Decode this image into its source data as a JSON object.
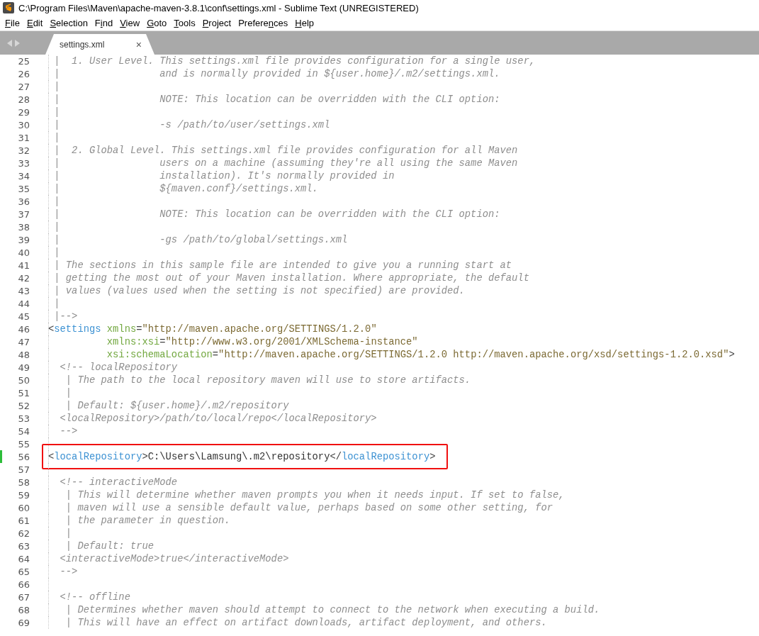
{
  "window": {
    "title": "C:\\Program Files\\Maven\\apache-maven-3.8.1\\conf\\settings.xml - Sublime Text (UNREGISTERED)"
  },
  "menu": [
    {
      "label": [
        {
          "text": "F",
          "underlined": true
        },
        {
          "text": "ile",
          "underlined": false
        }
      ]
    },
    {
      "label": [
        {
          "text": "E",
          "underlined": true
        },
        {
          "text": "dit",
          "underlined": false
        }
      ]
    },
    {
      "label": [
        {
          "text": "S",
          "underlined": true
        },
        {
          "text": "election",
          "underlined": false
        }
      ]
    },
    {
      "label": [
        {
          "text": "F",
          "underlined": false
        },
        {
          "text": "i",
          "underlined": true
        },
        {
          "text": "nd",
          "underlined": false
        }
      ]
    },
    {
      "label": [
        {
          "text": "V",
          "underlined": true
        },
        {
          "text": "iew",
          "underlined": false
        }
      ]
    },
    {
      "label": [
        {
          "text": "G",
          "underlined": true
        },
        {
          "text": "oto",
          "underlined": false
        }
      ]
    },
    {
      "label": [
        {
          "text": "T",
          "underlined": true
        },
        {
          "text": "ools",
          "underlined": false
        }
      ]
    },
    {
      "label": [
        {
          "text": "P",
          "underlined": true
        },
        {
          "text": "roject",
          "underlined": false
        }
      ]
    },
    {
      "label": [
        {
          "text": "Prefere",
          "underlined": false
        },
        {
          "text": "n",
          "underlined": true
        },
        {
          "text": "ces",
          "underlined": false
        }
      ]
    },
    {
      "label": [
        {
          "text": "H",
          "underlined": true
        },
        {
          "text": "elp",
          "underlined": false
        }
      ]
    }
  ],
  "tabs": [
    {
      "label": "settings.xml",
      "close": "×",
      "selected": true
    }
  ],
  "editor": {
    "lines": [
      {
        "number": "25",
        "parts": [
          {
            "kind": "comment",
            "text": " |  1. User Level. This settings.xml file provides configuration for a single user,"
          }
        ]
      },
      {
        "number": "26",
        "parts": [
          {
            "kind": "comment",
            "text": " |                 and is normally provided in ${user.home}/.m2/settings.xml."
          }
        ]
      },
      {
        "number": "27",
        "parts": [
          {
            "kind": "comment",
            "text": " |"
          }
        ]
      },
      {
        "number": "28",
        "parts": [
          {
            "kind": "comment",
            "text": " |                 NOTE: This location can be overridden with the CLI option:"
          }
        ]
      },
      {
        "number": "29",
        "parts": [
          {
            "kind": "comment",
            "text": " |"
          }
        ]
      },
      {
        "number": "30",
        "parts": [
          {
            "kind": "comment",
            "text": " |                 -s /path/to/user/settings.xml"
          }
        ]
      },
      {
        "number": "31",
        "parts": [
          {
            "kind": "comment",
            "text": " |"
          }
        ]
      },
      {
        "number": "32",
        "parts": [
          {
            "kind": "comment",
            "text": " |  2. Global Level. This settings.xml file provides configuration for all Maven"
          }
        ]
      },
      {
        "number": "33",
        "parts": [
          {
            "kind": "comment",
            "text": " |                 users on a machine (assuming they're all using the same Maven"
          }
        ]
      },
      {
        "number": "34",
        "parts": [
          {
            "kind": "comment",
            "text": " |                 installation). It's normally provided in"
          }
        ]
      },
      {
        "number": "35",
        "parts": [
          {
            "kind": "comment",
            "text": " |                 ${maven.conf}/settings.xml."
          }
        ]
      },
      {
        "number": "36",
        "parts": [
          {
            "kind": "comment",
            "text": " |"
          }
        ]
      },
      {
        "number": "37",
        "parts": [
          {
            "kind": "comment",
            "text": " |                 NOTE: This location can be overridden with the CLI option:"
          }
        ]
      },
      {
        "number": "38",
        "parts": [
          {
            "kind": "comment",
            "text": " |"
          }
        ]
      },
      {
        "number": "39",
        "parts": [
          {
            "kind": "comment",
            "text": " |                 -gs /path/to/global/settings.xml"
          }
        ]
      },
      {
        "number": "40",
        "parts": [
          {
            "kind": "comment",
            "text": " |"
          }
        ]
      },
      {
        "number": "41",
        "parts": [
          {
            "kind": "comment",
            "text": " | The sections in this sample file are intended to give you a running start at"
          }
        ]
      },
      {
        "number": "42",
        "parts": [
          {
            "kind": "comment",
            "text": " | getting the most out of your Maven installation. Where appropriate, the default"
          }
        ]
      },
      {
        "number": "43",
        "parts": [
          {
            "kind": "comment",
            "text": " | values (values used when the setting is not specified) are provided."
          }
        ]
      },
      {
        "number": "44",
        "parts": [
          {
            "kind": "comment",
            "text": " |"
          }
        ]
      },
      {
        "number": "45",
        "parts": [
          {
            "kind": "comment",
            "text": " |-->"
          }
        ]
      },
      {
        "number": "46",
        "parts": [
          {
            "kind": "punct",
            "text": "<"
          },
          {
            "kind": "tag",
            "text": "settings"
          },
          {
            "kind": "attr",
            "text": " xmlns"
          },
          {
            "kind": "punct",
            "text": "="
          },
          {
            "kind": "string",
            "text": "\"http://maven.apache.org/SETTINGS/1.2.0\""
          }
        ]
      },
      {
        "number": "47",
        "parts": [
          {
            "kind": "attr",
            "text": "          xmlns:xsi"
          },
          {
            "kind": "punct",
            "text": "="
          },
          {
            "kind": "string",
            "text": "\"http://www.w3.org/2001/XMLSchema-instance\""
          }
        ]
      },
      {
        "number": "48",
        "parts": [
          {
            "kind": "attr",
            "text": "          xsi:schemaLocation"
          },
          {
            "kind": "punct",
            "text": "="
          },
          {
            "kind": "string",
            "text": "\"http://maven.apache.org/SETTINGS/1.2.0 http://maven.apache.org/xsd/settings-1.2.0.xsd\""
          },
          {
            "kind": "punct",
            "text": ">"
          }
        ]
      },
      {
        "number": "49",
        "parts": [
          {
            "kind": "comment",
            "text": "  <!-- localRepository"
          }
        ]
      },
      {
        "number": "50",
        "parts": [
          {
            "kind": "comment",
            "text": "   | The path to the local repository maven will use to store artifacts."
          }
        ]
      },
      {
        "number": "51",
        "parts": [
          {
            "kind": "comment",
            "text": "   |"
          }
        ]
      },
      {
        "number": "52",
        "parts": [
          {
            "kind": "comment",
            "text": "   | Default: ${user.home}/.m2/repository"
          }
        ]
      },
      {
        "number": "53",
        "parts": [
          {
            "kind": "comment",
            "text": "  <localRepository>/path/to/local/repo</localRepository>"
          }
        ]
      },
      {
        "number": "54",
        "parts": [
          {
            "kind": "comment",
            "text": "  -->"
          }
        ]
      },
      {
        "number": "55"
      },
      {
        "number": "56",
        "modified": true,
        "annotated": true,
        "parts": [
          {
            "kind": "punct",
            "text": "<"
          },
          {
            "kind": "tag",
            "text": "localRepository"
          },
          {
            "kind": "punct",
            "text": ">"
          },
          {
            "kind": "text",
            "text": "C:\\Users\\Lamsung\\.m2\\repository"
          },
          {
            "kind": "punct",
            "text": "</"
          },
          {
            "kind": "tag",
            "text": "localRepository"
          },
          {
            "kind": "punct",
            "text": ">"
          }
        ]
      },
      {
        "number": "57"
      },
      {
        "number": "58",
        "parts": [
          {
            "kind": "comment",
            "text": "  <!-- interactiveMode"
          }
        ]
      },
      {
        "number": "59",
        "parts": [
          {
            "kind": "comment",
            "text": "   | This will determine whether maven prompts you when it needs input. If set to false,"
          }
        ]
      },
      {
        "number": "60",
        "parts": [
          {
            "kind": "comment",
            "text": "   | maven will use a sensible default value, perhaps based on some other setting, for"
          }
        ]
      },
      {
        "number": "61",
        "parts": [
          {
            "kind": "comment",
            "text": "   | the parameter in question."
          }
        ]
      },
      {
        "number": "62",
        "parts": [
          {
            "kind": "comment",
            "text": "   |"
          }
        ]
      },
      {
        "number": "63",
        "parts": [
          {
            "kind": "comment",
            "text": "   | Default: true"
          }
        ]
      },
      {
        "number": "64",
        "parts": [
          {
            "kind": "comment",
            "text": "  <interactiveMode>true</interactiveMode>"
          }
        ]
      },
      {
        "number": "65",
        "parts": [
          {
            "kind": "comment",
            "text": "  -->"
          }
        ]
      },
      {
        "number": "66"
      },
      {
        "number": "67",
        "parts": [
          {
            "kind": "comment",
            "text": "  <!-- offline"
          }
        ]
      },
      {
        "number": "68",
        "parts": [
          {
            "kind": "comment",
            "text": "   | Determines whether maven should attempt to connect to the network when executing a build."
          }
        ]
      },
      {
        "number": "69",
        "parts": [
          {
            "kind": "comment",
            "text": "   | This will have an effect on artifact downloads, artifact deployment, and others."
          }
        ]
      }
    ]
  }
}
